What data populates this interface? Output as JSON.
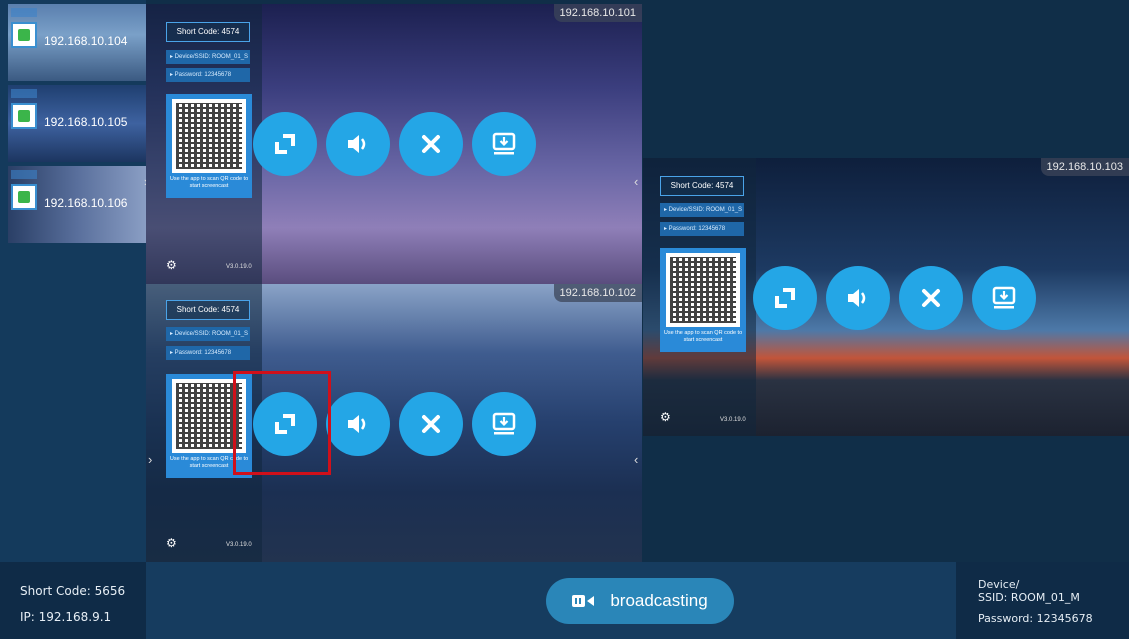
{
  "sidebar": {
    "items": [
      {
        "ip": "192.168.10.104"
      },
      {
        "ip": "192.168.10.105"
      },
      {
        "ip": "192.168.10.106"
      }
    ]
  },
  "screens": [
    {
      "ip": "192.168.10.101",
      "short_code": "Short Code: 4574",
      "ssid": "▸ Device/SSID: ROOM_01_S",
      "password": "▸ Password: 12345678",
      "qr_caption": "Use the app to scan QR code to start screencast",
      "version": "V3.0.19.0"
    },
    {
      "ip": "192.168.10.102",
      "short_code": "Short Code: 4574",
      "ssid": "▸ Device/SSID: ROOM_01_S",
      "password": "▸ Password: 12345678",
      "qr_caption": "Use the app to scan QR code to start screencast",
      "version": "V3.0.19.0"
    },
    {
      "ip": "192.168.10.103",
      "short_code": "Short Code: 4574",
      "ssid": "▸ Device/SSID: ROOM_01_S",
      "password": "▸ Password: 12345678",
      "qr_caption": "Use the app to scan QR code to start screencast",
      "version": "V3.0.19.0"
    }
  ],
  "controls": [
    "fullscreen-icon",
    "volume-icon",
    "close-icon",
    "download-screen-icon"
  ],
  "bottom": {
    "short_code": "Short Code: 5656",
    "ip": "IP: 192.168.9.1",
    "broadcast_label": "broadcasting",
    "device_label": "Device/",
    "ssid": "SSID: ROOM_01_M",
    "password": "Password: 12345678"
  },
  "colors": {
    "accent": "#24a6e6",
    "highlight": "#d0101a",
    "background": "#102e48"
  }
}
